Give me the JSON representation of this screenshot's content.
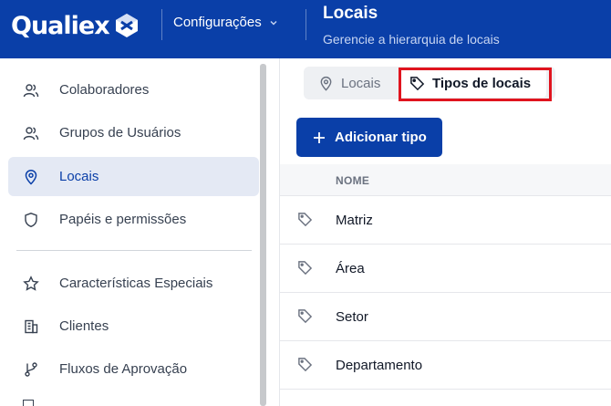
{
  "header": {
    "brand": "Qualiex",
    "section": "Configurações",
    "title": "Locais",
    "subtitle": "Gerencie a hierarquia de locais"
  },
  "sidebar": {
    "items": [
      {
        "label": "Colaboradores",
        "icon": "users-icon"
      },
      {
        "label": "Grupos de Usuários",
        "icon": "user-group-icon"
      },
      {
        "label": "Locais",
        "icon": "map-pin-icon",
        "active": true
      },
      {
        "label": "Papéis e permissões",
        "icon": "shield-icon"
      },
      {
        "label": "Características Especiais",
        "icon": "star-icon"
      },
      {
        "label": "Clientes",
        "icon": "building-icon"
      },
      {
        "label": "Fluxos de Aprovação",
        "icon": "git-branch-icon"
      }
    ]
  },
  "tabs": {
    "locais": "Locais",
    "tipos": "Tipos de locais"
  },
  "toolbar": {
    "add_label": "Adicionar tipo"
  },
  "table": {
    "column": "NOME",
    "rows": [
      "Matriz",
      "Área",
      "Setor",
      "Departamento"
    ]
  },
  "colors": {
    "brand": "#0a3fa8",
    "highlight": "#e0141e"
  }
}
